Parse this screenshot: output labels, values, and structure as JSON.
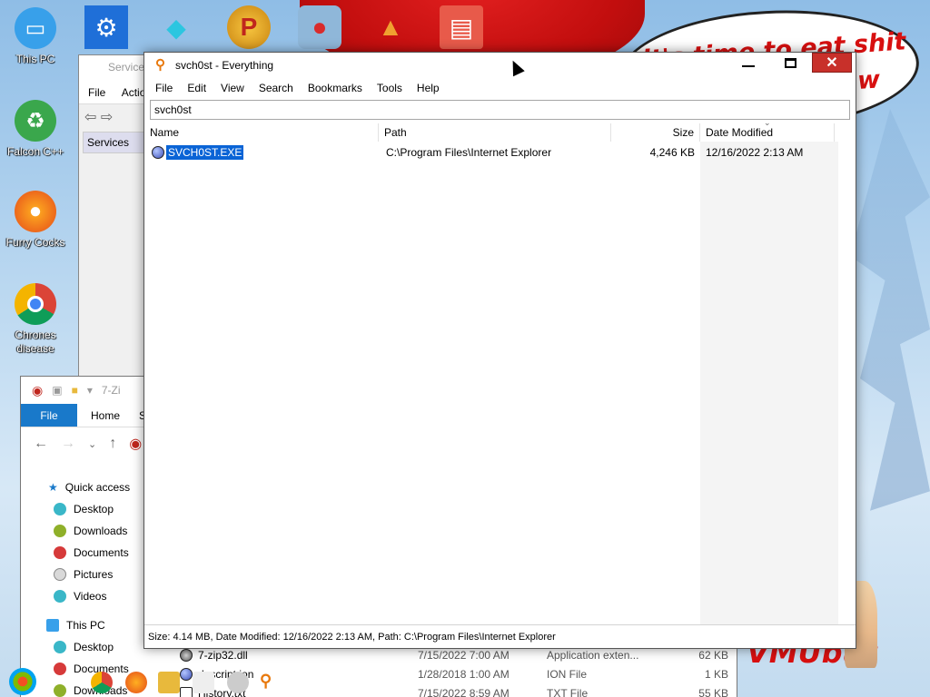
{
  "desktop": {
    "speech_text": "it's time to eat shit",
    "speech_text_line2": "w",
    "bottom_text": "VMUbut",
    "icons": [
      {
        "label": "This PC",
        "icon": "computer-icon"
      },
      {
        "label": "Falcon C++",
        "icon": "recycle-icon"
      },
      {
        "label": "Furry Cocks",
        "icon": "firefox-icon"
      },
      {
        "label": "Chrones disease",
        "icon": "chrome-icon"
      }
    ],
    "top_icons": [
      "settings-icon",
      "diamond-icon",
      "p-app-icon",
      "angry-bird-icon",
      "cake-icon",
      "book-icon"
    ]
  },
  "services_window": {
    "title": "Services",
    "menu": [
      "File",
      "Actio"
    ],
    "tree_item": "Services"
  },
  "everything_window": {
    "title": "svch0st - Everything",
    "menu": [
      "File",
      "Edit",
      "View",
      "Search",
      "Bookmarks",
      "Tools",
      "Help"
    ],
    "search_value": "svch0st",
    "columns": {
      "name": "Name",
      "path": "Path",
      "size": "Size",
      "date": "Date Modified"
    },
    "rows": [
      {
        "name": "SVCH0ST.EXE",
        "path": "C:\\Program Files\\Internet Explorer",
        "size": "4,246 KB",
        "date": "12/16/2022 2:13 AM"
      }
    ],
    "status": "Size: 4.14 MB, Date Modified: 12/16/2022 2:13 AM, Path: C:\\Program Files\\Internet Explorer"
  },
  "explorer_window": {
    "title": "7-Zi",
    "ribbon": {
      "file": "File",
      "home": "Home",
      "share": "S"
    },
    "sidebar": [
      {
        "label": "Quick access",
        "icon": "star-icon"
      },
      {
        "label": "Desktop",
        "icon": "desktop-icon"
      },
      {
        "label": "Downloads",
        "icon": "downloads-icon"
      },
      {
        "label": "Documents",
        "icon": "documents-icon"
      },
      {
        "label": "Pictures",
        "icon": "pictures-icon"
      },
      {
        "label": "Videos",
        "icon": "videos-icon"
      },
      {
        "label": "This PC",
        "icon": "computer-icon"
      },
      {
        "label": "Desktop",
        "icon": "desktop-icon"
      },
      {
        "label": "Documents",
        "icon": "documents-icon"
      },
      {
        "label": "Downloads",
        "icon": "downloads-icon"
      }
    ],
    "files": [
      {
        "name": "7-zip32.dll",
        "date": "7/15/2022 7:00 AM",
        "type": "Application exten...",
        "size": "62 KB"
      },
      {
        "name": "descript.ion",
        "date": "1/28/2018 1:00 AM",
        "type": "ION File",
        "size": "1 KB"
      },
      {
        "name": "History.txt",
        "date": "7/15/2022 8:59 AM",
        "type": "TXT File",
        "size": "55 KB"
      }
    ]
  }
}
